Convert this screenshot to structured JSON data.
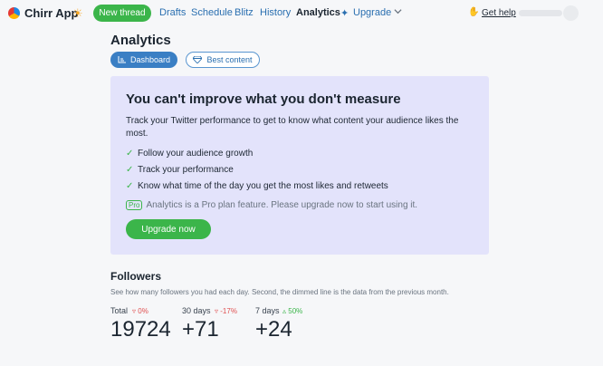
{
  "header": {
    "app_name": "Chirr App",
    "new_thread": "New thread",
    "nav": [
      {
        "label": "Drafts",
        "active": false
      },
      {
        "label": "Schedule",
        "active": false
      },
      {
        "label": "Blitz",
        "active": false
      },
      {
        "label": "History",
        "active": false
      },
      {
        "label": "Analytics",
        "active": true
      },
      {
        "label": "Upgrade",
        "active": false
      }
    ],
    "help": "Get help",
    "icons": {
      "logo": "chirr-logo-icon",
      "theme": "sun-icon",
      "upgrade": "rocket-icon",
      "more": "chevron-down-icon",
      "help": "wave-hand-icon"
    }
  },
  "page": {
    "title": "Analytics",
    "tabs": [
      {
        "label": "Dashboard",
        "icon": "chart-icon",
        "active": true
      },
      {
        "label": "Best content",
        "icon": "diamond-icon",
        "active": false
      }
    ]
  },
  "promo": {
    "title": "You can't improve what you don't measure",
    "description": "Track your Twitter performance to get to know what content your audience likes the most.",
    "features": [
      "Follow your audience growth",
      "Track your performance",
      "Know what time of the day you get the most likes and retweets"
    ],
    "pro_badge": "Pro",
    "pro_text": "Analytics is a Pro plan feature. Please upgrade now to start using it.",
    "cta": "Upgrade now"
  },
  "followers": {
    "title": "Followers",
    "description": "See how many followers you had each day. Second, the dimmed line is the data from the previous month.",
    "stats": [
      {
        "label": "Total",
        "delta": "0%",
        "direction": "down",
        "value": "19724"
      },
      {
        "label": "30 days",
        "delta": "-17%",
        "direction": "down",
        "value": "+71"
      },
      {
        "label": "7 days",
        "delta": "50%",
        "direction": "up",
        "value": "+24"
      }
    ]
  },
  "colors": {
    "accent_green": "#3bb54a",
    "accent_blue": "#3a7fc4",
    "promo_bg": "#e3e3fb",
    "down": "#e05050"
  }
}
